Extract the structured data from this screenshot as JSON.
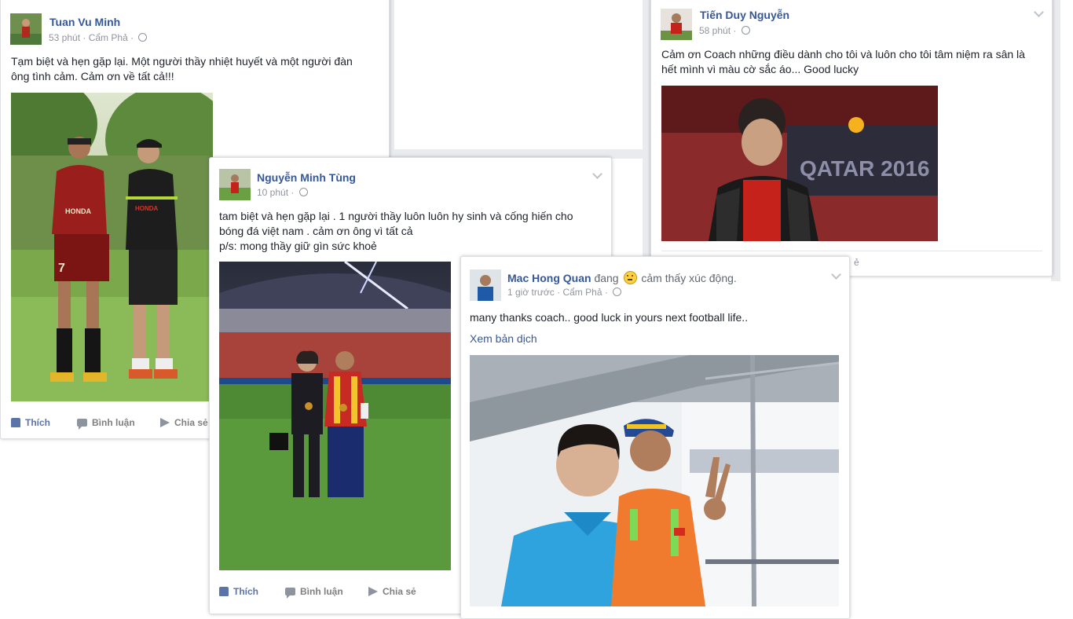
{
  "actions": {
    "like": "Thích",
    "comment": "Bình luận",
    "share": "Chia sẻ"
  },
  "posts": [
    {
      "author": "Tuan Vu Minh",
      "time": "53 phút",
      "location": "Cẩm Phả",
      "text": "Tạm biệt và hẹn gặp lại. Một người thầy nhiệt huyết và một người đàn ông tình cảm. Cảm ơn về tất cả!!!",
      "photo_shirt_text": "HONDA",
      "photo_number": "7"
    },
    {
      "author": "Tiến Duy Nguyễn",
      "time": "58 phút",
      "text": "Cảm ơn Coach những điều dành cho tôi và luôn cho tôi tâm niệm ra sân là hết mình vì màu cờ sắc áo... Good lucky",
      "photo_banner_text": "QATAR 2016",
      "footer_fragment": "ẻ"
    },
    {
      "author": "Nguyễn Minh Tùng",
      "time": "10 phút",
      "text_line1": "tam biệt và hẹn gặp lại . 1 người thầy luôn luôn hy sinh và cống hiến cho bóng đá việt nam . cảm ơn ông vì tất cả",
      "text_line2": "p/s: mong thầy giữ gìn sức khoẻ"
    },
    {
      "author": "Mac Hong Quan",
      "verb": "đang",
      "feeling": "cảm thấy xúc động.",
      "time": "1 giờ trước",
      "location": "Cẩm Phả",
      "text": "many thanks coach.. good luck in yours next football life..",
      "translate": "Xem bản dịch"
    }
  ],
  "colors": {
    "link": "#365899",
    "meta": "#90949c",
    "like": "#5b74a8",
    "background": "#e9ebee"
  }
}
